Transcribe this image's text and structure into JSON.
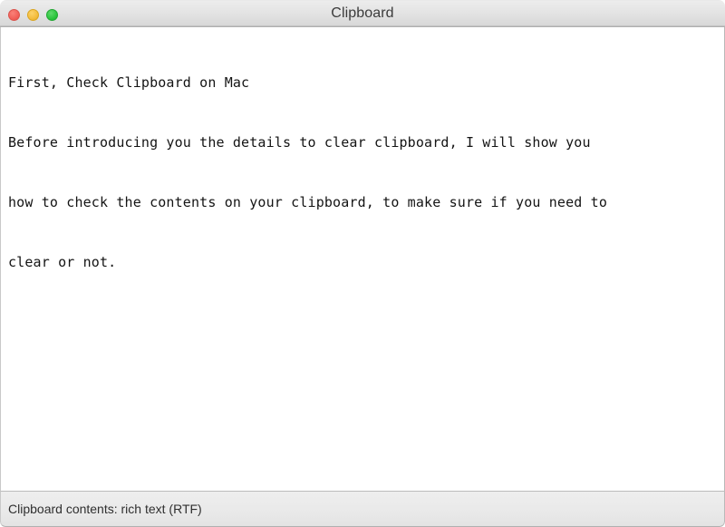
{
  "window": {
    "title": "Clipboard",
    "controls": [
      {
        "name": "close-button",
        "label": "Close",
        "color": "#f2615a"
      },
      {
        "name": "minimize-button",
        "label": "Minimize",
        "color": "#f4bd3f"
      },
      {
        "name": "zoom-button",
        "label": "Zoom",
        "color": "#2ec63f"
      }
    ]
  },
  "content": {
    "lines": [
      "First, Check Clipboard on Mac",
      "Before introducing you the details to clear clipboard, I will show you",
      "how to check the contents on your clipboard, to make sure if you need to",
      "clear or not."
    ]
  },
  "statusbar": {
    "text": "Clipboard contents: rich text (RTF)"
  }
}
